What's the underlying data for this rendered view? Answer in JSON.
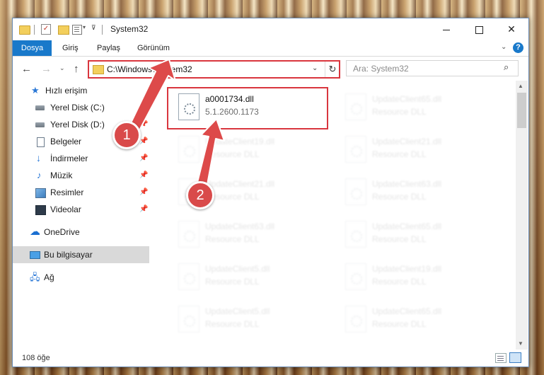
{
  "window": {
    "title": "System32",
    "quick_access_dropdown": "▾",
    "quick_access_customize": "⊽",
    "minimize": "",
    "maximize": "",
    "close": "✕"
  },
  "ribbon": {
    "tabs": [
      "Dosya",
      "Giriş",
      "Paylaş",
      "Görünüm"
    ],
    "expand": "⌄",
    "help": "?"
  },
  "navigation": {
    "back": "←",
    "forward": "→",
    "recent": "⌄",
    "up": "↑",
    "address": "C:\\Windows\\System32",
    "address_dropdown": "⌄",
    "refresh": "↻",
    "search_placeholder": "Ara: System32",
    "search_icon": "⌕"
  },
  "sidebar": {
    "items": [
      {
        "label": "Hızlı erişim",
        "icon": "star-icon",
        "pinned": false
      },
      {
        "label": "Yerel Disk (C:)",
        "icon": "drive-icon",
        "pinned": true
      },
      {
        "label": "Yerel Disk (D:)",
        "icon": "drive-icon",
        "pinned": true
      },
      {
        "label": "Belgeler",
        "icon": "document-icon",
        "pinned": true
      },
      {
        "label": "İndirmeler",
        "icon": "download-icon",
        "pinned": true
      },
      {
        "label": "Müzik",
        "icon": "music-icon",
        "pinned": true
      },
      {
        "label": "Resimler",
        "icon": "pictures-icon",
        "pinned": true
      },
      {
        "label": "Videolar",
        "icon": "video-icon",
        "pinned": true
      },
      {
        "label": "OneDrive",
        "icon": "cloud-icon",
        "pinned": false
      },
      {
        "label": "Bu bilgisayar",
        "icon": "computer-icon",
        "pinned": false,
        "selected": true
      },
      {
        "label": "Ağ",
        "icon": "network-icon",
        "pinned": false
      }
    ],
    "pin_glyph": "📌"
  },
  "files": {
    "highlighted": {
      "name": "a0001734.dll",
      "detail": "5.1.2600.1173"
    },
    "blurred": [
      {
        "name": "UpdateClient65.dll",
        "detail": "Resource DLL"
      },
      {
        "name": "UpdateClient19.dll",
        "detail": "Resource DLL"
      },
      {
        "name": "UpdateClient21.dll",
        "detail": "Resource DLL"
      },
      {
        "name": "UpdateClient21.dll",
        "detail": "Resource DLL"
      },
      {
        "name": "UpdateClient63.dll",
        "detail": "Resource DLL"
      },
      {
        "name": "UpdateClient63.dll",
        "detail": "Resource DLL"
      },
      {
        "name": "UpdateClient65.dll",
        "detail": "Resource DLL"
      },
      {
        "name": "UpdateClient5.dll",
        "detail": "Resource DLL"
      },
      {
        "name": "UpdateClient19.dll",
        "detail": "Resource DLL"
      },
      {
        "name": "UpdateClient5.dll",
        "detail": "Resource DLL"
      },
      {
        "name": "UpdateClient65.dll",
        "detail": "Resource DLL"
      }
    ]
  },
  "status": {
    "item_count": "108 öğe"
  },
  "annotations": {
    "step1": "1",
    "step2": "2"
  },
  "colors": {
    "accent": "#1979ca",
    "highlight": "#d9363e",
    "annotation": "#dd4a4a"
  }
}
